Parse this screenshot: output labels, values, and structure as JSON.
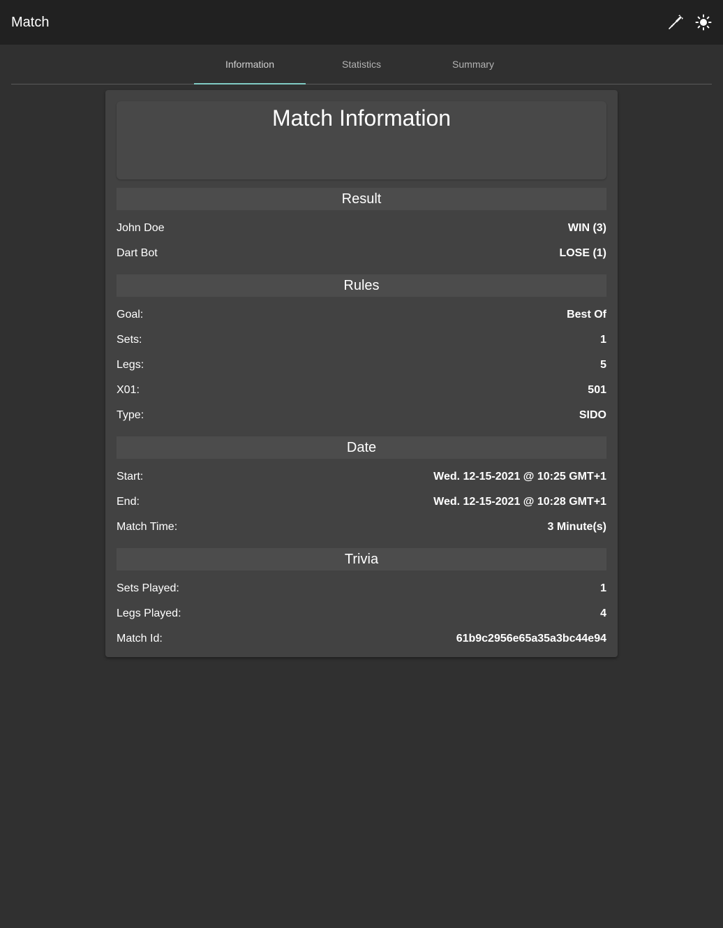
{
  "topbar": {
    "title": "Match",
    "icons": [
      "dart-icon",
      "brightness-icon"
    ]
  },
  "tabs": [
    {
      "label": "Information",
      "active": true
    },
    {
      "label": "Statistics",
      "active": false
    },
    {
      "label": "Summary",
      "active": false
    }
  ],
  "colors": {
    "background": "#303030",
    "topbar": "#212121",
    "card": "#424242",
    "tab_indicator": "#80cbc4"
  },
  "card": {
    "title": "Match Information",
    "sections": {
      "result": {
        "title": "Result",
        "rows": [
          {
            "label": "John Doe",
            "value": "WIN (3)"
          },
          {
            "label": "Dart Bot",
            "value": "LOSE (1)"
          }
        ]
      },
      "rules": {
        "title": "Rules",
        "rows": [
          {
            "label": "Goal:",
            "value": "Best Of"
          },
          {
            "label": "Sets:",
            "value": "1"
          },
          {
            "label": "Legs:",
            "value": "5"
          },
          {
            "label": "X01:",
            "value": "501"
          },
          {
            "label": "Type:",
            "value": "SIDO"
          }
        ]
      },
      "date": {
        "title": "Date",
        "rows": [
          {
            "label": "Start:",
            "value": "Wed. 12-15-2021 @ 10:25 GMT+1"
          },
          {
            "label": "End:",
            "value": "Wed. 12-15-2021 @ 10:28 GMT+1"
          },
          {
            "label": "Match Time:",
            "value": "3 Minute(s)"
          }
        ]
      },
      "trivia": {
        "title": "Trivia",
        "rows": [
          {
            "label": "Sets Played:",
            "value": "1"
          },
          {
            "label": "Legs Played:",
            "value": "4"
          },
          {
            "label": "Match Id:",
            "value": "61b9c2956e65a35a3bc44e94"
          }
        ]
      }
    }
  }
}
